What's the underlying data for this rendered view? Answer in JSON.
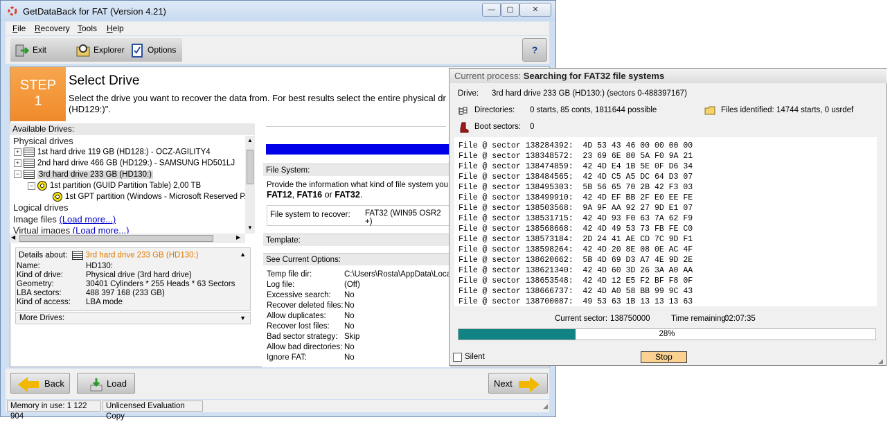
{
  "window": {
    "title": "GetDataBack for FAT (Version 4.21)",
    "controls": {
      "minimize": "—",
      "maximize": "▢",
      "close": "✕"
    }
  },
  "menu": [
    "File",
    "Recovery",
    "Tools",
    "Help"
  ],
  "toolbar": {
    "exit": "Exit",
    "explorer": "Explorer",
    "options": "Options",
    "help_icon": "?"
  },
  "step": {
    "label": "STEP",
    "number": "1",
    "title": "Select Drive",
    "description": "Select the drive you want to recover the data from. For best results select the entire physical dr",
    "description_2": "(HD129:)\"."
  },
  "available_drives": {
    "label": "Available Drives:",
    "physical_group": "Physical drives",
    "drives": [
      "1st hard drive 119 GB (HD128:) - OCZ-AGILITY4",
      "2nd hard drive 466 GB (HD129:) - SAMSUNG HD501LJ",
      "3rd hard drive 233 GB (HD130:)"
    ],
    "partition": "1st partition (GUID Partition Table) 2,00 TB",
    "gpt_partition": "1st GPT partition (Windows - Microsoft Reserved P...",
    "logical_group": "Logical drives",
    "image_files": "Image files",
    "image_link": "(Load more...)",
    "virtual_images": "Virtual images",
    "virtual_link": "(Load more...)"
  },
  "details": {
    "header": "Details about:",
    "selected": "3rd hard drive 233 GB (HD130:)",
    "rows": [
      {
        "label": "Name:",
        "value": "HD130:"
      },
      {
        "label": "Kind of drive:",
        "value": "Physical drive (3rd hard drive)"
      },
      {
        "label": "Geometry:",
        "value": "30401 Cylinders * 255 Heads * 63 Sectors"
      },
      {
        "label": "LBA sectors:",
        "value": "488 397 168 (233 GB)"
      },
      {
        "label": "Kind of access:",
        "value": "LBA mode"
      }
    ],
    "more_drives": "More Drives:"
  },
  "file_system": {
    "header": "File System:",
    "text": "Provide the information what kind of file system you are l",
    "fat12": "FAT12",
    "fat16": "FAT16",
    "or": "or",
    "fat32": "FAT32",
    "recover_label": "File system to recover:",
    "recover_value": "FAT32 (WIN95 OSR2 +)"
  },
  "template": {
    "header": "Template:"
  },
  "current_options": {
    "header": "See Current Options:",
    "rows": [
      {
        "label": "Temp file dir:",
        "value": "C:\\Users\\Rosta\\AppData\\Loca"
      },
      {
        "label": "Log file:",
        "value": "(Off)"
      },
      {
        "label": "Excessive search:",
        "value": "No"
      },
      {
        "label": "Recover deleted files:",
        "value": "No"
      },
      {
        "label": "Allow duplicates:",
        "value": "No"
      },
      {
        "label": "Recover lost files:",
        "value": "No"
      },
      {
        "label": "Bad sector strategy:",
        "value": "Skip"
      },
      {
        "label": "Allow bad directories:",
        "value": "No"
      },
      {
        "label": "Ignore FAT:",
        "value": "No"
      }
    ]
  },
  "nav": {
    "back": "Back",
    "load": "Load",
    "next": "Next"
  },
  "status": {
    "memory": "Memory in use: 1 122 904",
    "license": "Unlicensed Evaluation Copy"
  },
  "process": {
    "prefix": "Current process:",
    "title": "Searching for FAT32 file systems",
    "drive_label": "Drive:",
    "drive_value": "3rd hard drive 233 GB (HD130:) (sectors 0-488397167)",
    "dirs_label": "Directories:",
    "dirs_value": "0 starts, 85 conts, 1811644 possible",
    "files_label": "Files identified:",
    "files_value": "14744 starts, 0 usrdef",
    "boot_label": "Boot sectors:",
    "boot_value": "0",
    "log": [
      "File @ sector 138284392:  4D 53 43 46 00 00 00 00",
      "File @ sector 138348572:  23 69 6E 80 5A F0 9A 21",
      "File @ sector 138474859:  42 4D E4 1B 5E 0F D6 34",
      "File @ sector 138484565:  42 4D C5 A5 DC 64 D3 07",
      "File @ sector 138495303:  5B 56 65 70 2B 42 F3 03",
      "File @ sector 138499910:  42 4D EF BB 2F E0 EE FE",
      "File @ sector 138503568:  9A 9F AA 92 27 9D E1 07",
      "File @ sector 138531715:  42 4D 93 F0 63 7A 62 F9",
      "File @ sector 138568668:  42 4D 49 53 73 FB FE C0",
      "File @ sector 138573184:  2D 24 41 AE CD 7C 9D F1",
      "File @ sector 138598264:  42 4D 20 8E 08 0E AC 4F",
      "File @ sector 138620662:  5B 4D 69 D3 A7 4E 9D 2E",
      "File @ sector 138621340:  42 4D 60 3D 26 3A A0 AA",
      "File @ sector 138653548:  42 4D 12 E5 F2 BF F8 0F",
      "File @ sector 138666737:  42 4D A0 58 BB 99 9C 43",
      "File @ sector 138700087:  49 53 63 1B 13 13 13 63"
    ],
    "current_sector_label": "Current sector:",
    "current_sector": "138750000",
    "time_label": "Time remaining:",
    "time_value": "02:07:35",
    "progress_fraction": 0.28,
    "progress_text": "28%",
    "silent": "Silent",
    "stop": "Stop"
  },
  "colors": {
    "progress": "#118383",
    "step_orange": "#f08a2a",
    "stop_button": "#fbd192",
    "link": "#0000cc"
  }
}
